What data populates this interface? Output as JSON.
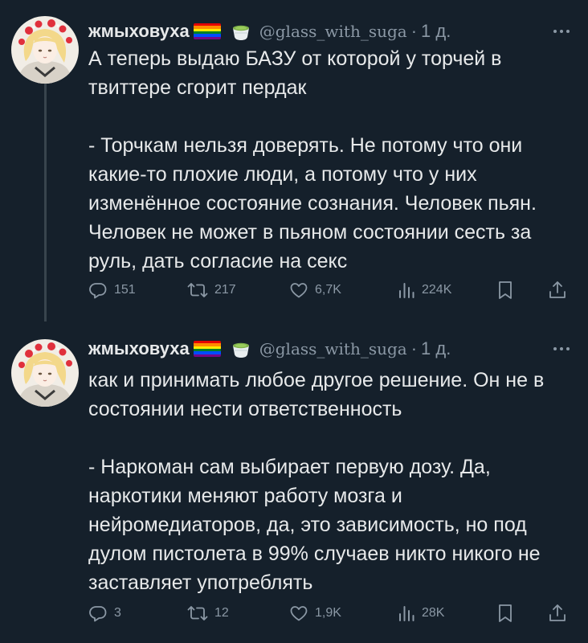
{
  "colors": {
    "background": "#15202b",
    "text_primary": "#e7e9ea",
    "text_secondary": "#8b98a5",
    "thread_line": "#38444d"
  },
  "tweets": [
    {
      "author": {
        "display_name": "жмыховуха",
        "flag_icon": "rainbow-flag-icon",
        "badge_icon": "green-tea-icon",
        "handle": "@glass_with_suga",
        "separator": "·",
        "time": "1 д."
      },
      "paragraphs": [
        "А теперь выдаю БАЗУ от которой у торчей в твиттере сгорит пердак",
        "- Торчкам нельзя доверять. Не потому что они какие-то плохие люди, а потому что у них изменённое состояние сознания. Человек пьян. Человек не может в пьяном состоянии сесть за руль, дать согласие на секс"
      ],
      "stats": {
        "replies": "151",
        "retweets": "217",
        "likes": "6,7K",
        "views": "224K"
      }
    },
    {
      "author": {
        "display_name": "жмыховуха",
        "flag_icon": "rainbow-flag-icon",
        "badge_icon": "green-tea-icon",
        "handle": "@glass_with_suga",
        "separator": "·",
        "time": "1 д."
      },
      "paragraphs": [
        "как и принимать любое другое решение. Он не в состоянии нести ответственность",
        "- Наркоман сам выбирает первую дозу. Да, наркотики меняют работу мозга и нейромедиаторов, да, это зависимость, но под дулом пистолета в 99% случаев никто никого не заставляет употреблять"
      ],
      "stats": {
        "replies": "3",
        "retweets": "12",
        "likes": "1,9K",
        "views": "28K"
      }
    }
  ]
}
